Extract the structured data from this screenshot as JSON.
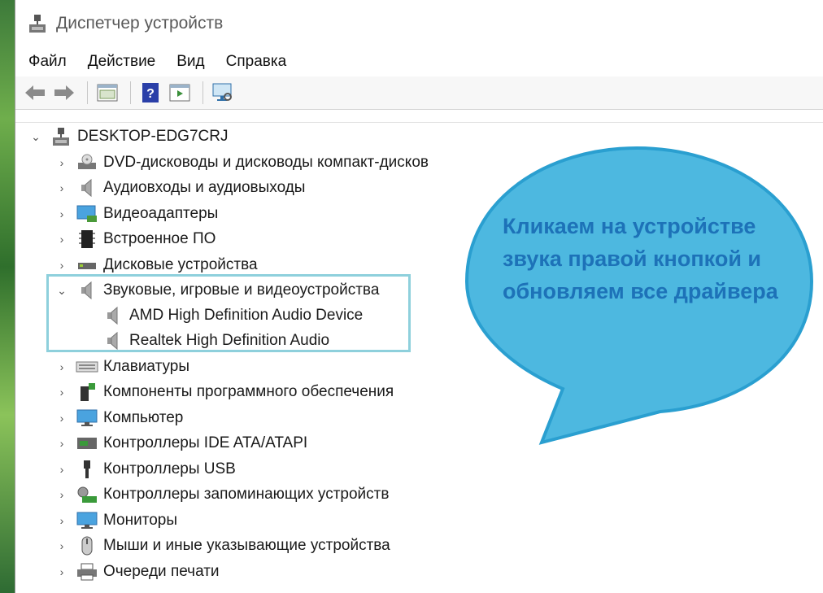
{
  "window": {
    "title": "Диспетчер устройств"
  },
  "menu": [
    "Файл",
    "Действие",
    "Вид",
    "Справка"
  ],
  "tree": {
    "root": "DESKTOP-EDG7CRJ",
    "items": [
      {
        "label": "DVD-дисководы и дисководы компакт-дисков",
        "icon": "dvd-drive-icon"
      },
      {
        "label": "Аудиовходы и аудиовыходы",
        "icon": "speaker-icon"
      },
      {
        "label": "Видеоадаптеры",
        "icon": "display-adapter-icon"
      },
      {
        "label": "Встроенное ПО",
        "icon": "firmware-chip-icon"
      },
      {
        "label": "Дисковые устройства",
        "icon": "disk-drive-icon"
      },
      {
        "label": "Звуковые, игровые и видеоустройства",
        "icon": "speaker-icon",
        "expanded": true,
        "children": [
          "AMD High Definition Audio Device",
          "Realtek High Definition Audio"
        ]
      },
      {
        "label": "Клавиатуры",
        "icon": "keyboard-icon"
      },
      {
        "label": "Компоненты программного обеспечения",
        "icon": "software-component-icon"
      },
      {
        "label": "Компьютер",
        "icon": "computer-icon"
      },
      {
        "label": "Контроллеры IDE ATA/ATAPI",
        "icon": "ide-controller-icon"
      },
      {
        "label": "Контроллеры USB",
        "icon": "usb-icon"
      },
      {
        "label": "Контроллеры запоминающих устройств",
        "icon": "storage-controller-icon"
      },
      {
        "label": "Мониторы",
        "icon": "monitor-icon"
      },
      {
        "label": "Мыши и иные указывающие устройства",
        "icon": "mouse-icon"
      },
      {
        "label": "Очереди печати",
        "icon": "printer-icon"
      }
    ]
  },
  "callout": {
    "text": "Кликаем на устройстве звука правой кнопкой и обновляем все драйвера"
  },
  "colors": {
    "callout_fill": "#4db8e0",
    "callout_border": "#2a9fd0",
    "callout_text": "#1d72b8",
    "highlight_border": "#8ed0dc"
  }
}
